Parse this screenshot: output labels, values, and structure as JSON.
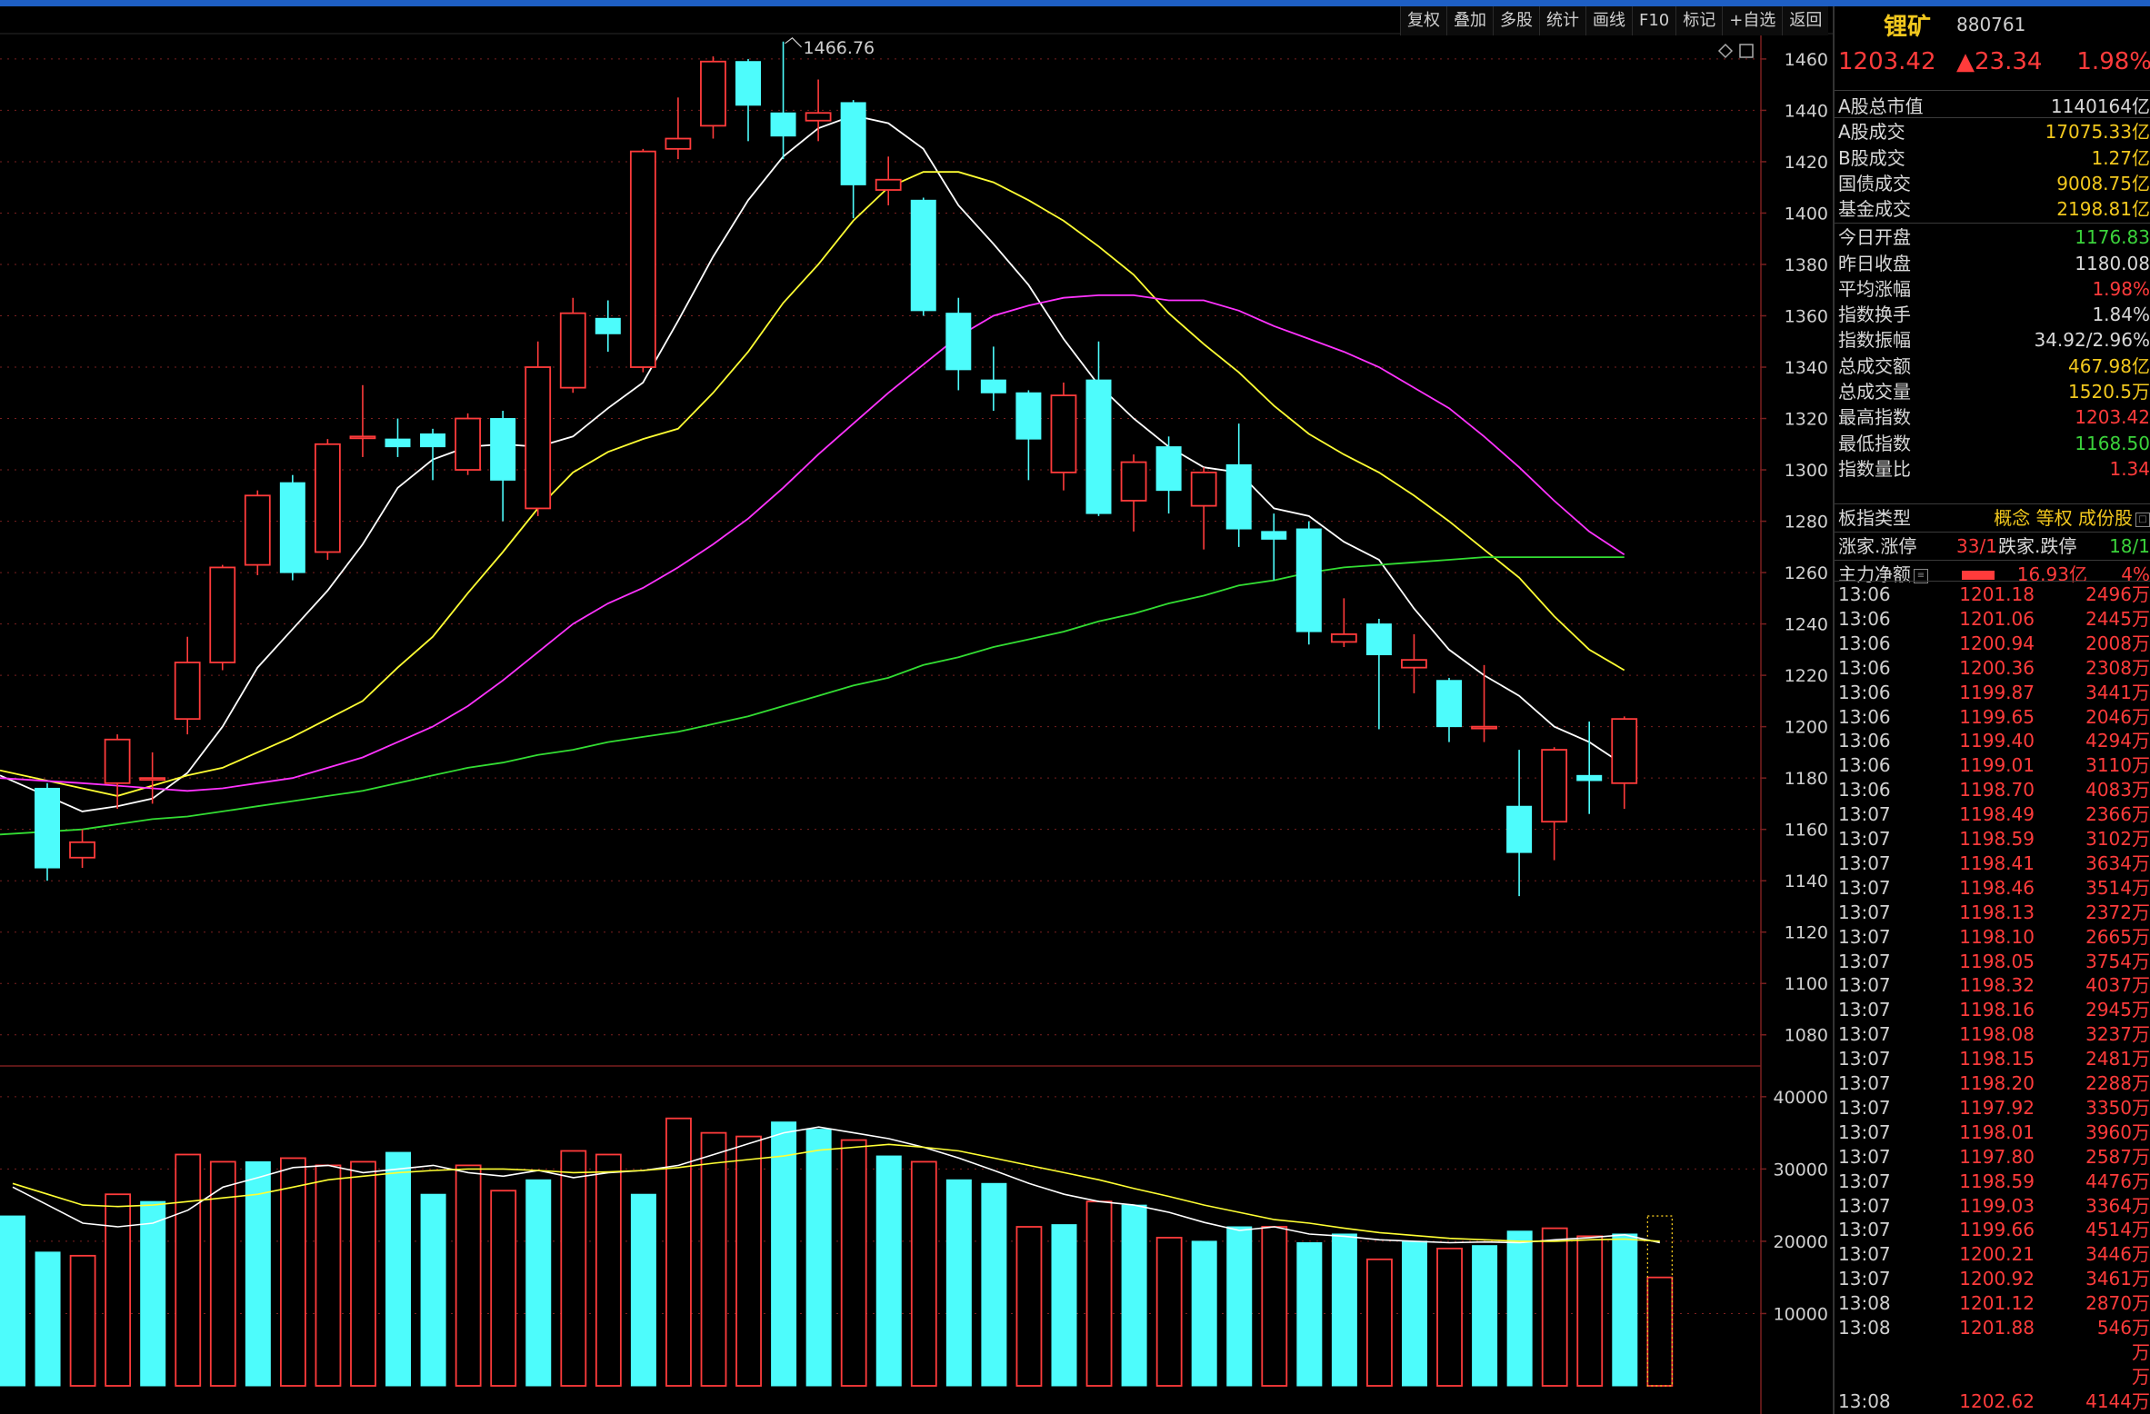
{
  "window": {
    "accent": "#1e5fc4"
  },
  "toolbar": {
    "items": [
      "复权",
      "叠加",
      "多股",
      "统计",
      "画线",
      "F10",
      "标记",
      "+自选",
      "返回"
    ]
  },
  "chart_corner_icons": [
    "diamond-icon",
    "window-toggle-icon"
  ],
  "quote": {
    "name": "锂矿",
    "code": "880761",
    "price": "1203.42",
    "change": "▲23.34",
    "change_pct": "1.98%"
  },
  "stats": [
    {
      "label": "A股总市值",
      "value": "1140164亿",
      "color": "#d8d8d8"
    },
    {
      "label": "A股成交",
      "value": "17075.33亿",
      "color": "#f2c81e"
    },
    {
      "label": "B股成交",
      "value": "1.27亿",
      "color": "#f2c81e"
    },
    {
      "label": "国债成交",
      "value": "9008.75亿",
      "color": "#f2c81e"
    },
    {
      "label": "基金成交",
      "value": "2198.81亿",
      "color": "#f2c81e"
    },
    {
      "label": "今日开盘",
      "value": "1176.83",
      "color": "#3bd33b"
    },
    {
      "label": "昨日收盘",
      "value": "1180.08",
      "color": "#d8d8d8"
    },
    {
      "label": "平均涨幅",
      "value": "1.98%",
      "color": "#ff3b3b"
    },
    {
      "label": "指数换手",
      "value": "1.84%",
      "color": "#d8d8d8"
    },
    {
      "label": "指数振幅",
      "value": "34.92/2.96%",
      "color": "#d8d8d8"
    },
    {
      "label": "总成交额",
      "value": "467.98亿",
      "color": "#f2c81e"
    },
    {
      "label": "总成交量",
      "value": "1520.5万",
      "color": "#f2c81e"
    },
    {
      "label": "最高指数",
      "value": "1203.42",
      "color": "#ff3b3b"
    },
    {
      "label": "最低指数",
      "value": "1168.50",
      "color": "#3bd33b"
    },
    {
      "label": "指数量比",
      "value": "1.34",
      "color": "#ff3b3b"
    }
  ],
  "board": {
    "label": "板指类型",
    "types": "概念 等权 成份股"
  },
  "updown": {
    "up_label": "涨家.涨停",
    "up_value": "33/1",
    "down_label": "跌家.跌停",
    "down_value": "18/1"
  },
  "mainflow": {
    "label": "主力净额",
    "value": "16.93亿",
    "pct": "4%"
  },
  "ticks": [
    {
      "t": "13:06",
      "p": "1201.18",
      "v": "2496万"
    },
    {
      "t": "13:06",
      "p": "1201.06",
      "v": "2445万"
    },
    {
      "t": "13:06",
      "p": "1200.94",
      "v": "2008万"
    },
    {
      "t": "13:06",
      "p": "1200.36",
      "v": "2308万"
    },
    {
      "t": "13:06",
      "p": "1199.87",
      "v": "3441万"
    },
    {
      "t": "13:06",
      "p": "1199.65",
      "v": "2046万"
    },
    {
      "t": "13:06",
      "p": "1199.40",
      "v": "4294万"
    },
    {
      "t": "13:06",
      "p": "1199.01",
      "v": "3110万"
    },
    {
      "t": "13:06",
      "p": "1198.70",
      "v": "4083万"
    },
    {
      "t": "13:07",
      "p": "1198.49",
      "v": "2366万"
    },
    {
      "t": "13:07",
      "p": "1198.59",
      "v": "3102万"
    },
    {
      "t": "13:07",
      "p": "1198.41",
      "v": "3634万"
    },
    {
      "t": "13:07",
      "p": "1198.46",
      "v": "3514万"
    },
    {
      "t": "13:07",
      "p": "1198.13",
      "v": "2372万"
    },
    {
      "t": "13:07",
      "p": "1198.10",
      "v": "2665万"
    },
    {
      "t": "13:07",
      "p": "1198.05",
      "v": "3754万"
    },
    {
      "t": "13:07",
      "p": "1198.32",
      "v": "4037万"
    },
    {
      "t": "13:07",
      "p": "1198.16",
      "v": "2945万"
    },
    {
      "t": "13:07",
      "p": "1198.08",
      "v": "3237万"
    },
    {
      "t": "13:07",
      "p": "1198.15",
      "v": "2481万"
    },
    {
      "t": "13:07",
      "p": "1198.20",
      "v": "2288万"
    },
    {
      "t": "13:07",
      "p": "1197.92",
      "v": "3350万"
    },
    {
      "t": "13:07",
      "p": "1198.01",
      "v": "3960万"
    },
    {
      "t": "13:07",
      "p": "1197.80",
      "v": "2587万"
    },
    {
      "t": "13:07",
      "p": "1198.59",
      "v": "4476万"
    },
    {
      "t": "13:07",
      "p": "1199.03",
      "v": "3364万"
    },
    {
      "t": "13:07",
      "p": "1199.66",
      "v": "4514万"
    },
    {
      "t": "13:07",
      "p": "1200.21",
      "v": "3446万"
    },
    {
      "t": "13:07",
      "p": "1200.92",
      "v": "3461万"
    },
    {
      "t": "13:08",
      "p": "1201.12",
      "v": "2870万"
    },
    {
      "t": "13:08",
      "p": "1201.88",
      "v": "546万"
    },
    {
      "t": "",
      "p": "",
      "v": "万"
    },
    {
      "t": "",
      "p": "",
      "v": "万"
    },
    {
      "t": "13:08",
      "p": "1202.62",
      "v": "4144万"
    }
  ],
  "colors": {
    "up": "#ff3b3b",
    "down": "#4dfcfc",
    "ma5": "#ffffff",
    "ma10": "#ffff33",
    "ma20": "#ff33ff",
    "ma60": "#33dd33",
    "grid": "#7a1f1f"
  },
  "chart_data": {
    "type": "candlestick",
    "price_axis": {
      "ylim": [
        1070,
        1472
      ],
      "ticks": [
        1080,
        1100,
        1120,
        1140,
        1160,
        1180,
        1200,
        1220,
        1240,
        1260,
        1280,
        1300,
        1320,
        1340,
        1360,
        1380,
        1400,
        1420,
        1440,
        1460
      ]
    },
    "max_label": "1466.76",
    "max_value": 1466.76,
    "candles": [
      {
        "o": 1176,
        "c": 1145,
        "h": 1178,
        "l": 1140
      },
      {
        "o": 1149,
        "c": 1155,
        "h": 1160,
        "l": 1145
      },
      {
        "o": 1178,
        "c": 1195,
        "h": 1197,
        "l": 1168
      },
      {
        "o": 1180,
        "c": 1180,
        "h": 1190,
        "l": 1170
      },
      {
        "o": 1203,
        "c": 1225,
        "h": 1235,
        "l": 1197
      },
      {
        "o": 1225,
        "c": 1262,
        "h": 1263,
        "l": 1222
      },
      {
        "o": 1263,
        "c": 1290,
        "h": 1292,
        "l": 1259
      },
      {
        "o": 1295,
        "c": 1260,
        "h": 1298,
        "l": 1257
      },
      {
        "o": 1268,
        "c": 1310,
        "h": 1312,
        "l": 1265
      },
      {
        "o": 1313,
        "c": 1313,
        "h": 1333,
        "l": 1305
      },
      {
        "o": 1312,
        "c": 1309,
        "h": 1320,
        "l": 1305
      },
      {
        "o": 1314,
        "c": 1309,
        "h": 1316,
        "l": 1296
      },
      {
        "o": 1300,
        "c": 1320,
        "h": 1322,
        "l": 1298
      },
      {
        "o": 1320,
        "c": 1296,
        "h": 1323,
        "l": 1280
      },
      {
        "o": 1285,
        "c": 1340,
        "h": 1350,
        "l": 1282
      },
      {
        "o": 1332,
        "c": 1361,
        "h": 1367,
        "l": 1330
      },
      {
        "o": 1359,
        "c": 1353,
        "h": 1366,
        "l": 1346
      },
      {
        "o": 1340,
        "c": 1424,
        "h": 1425,
        "l": 1338
      },
      {
        "o": 1425,
        "c": 1429,
        "h": 1445,
        "l": 1421
      },
      {
        "o": 1434,
        "c": 1459,
        "h": 1461,
        "l": 1429
      },
      {
        "o": 1459,
        "c": 1442,
        "h": 1460,
        "l": 1428
      },
      {
        "o": 1439,
        "c": 1430,
        "h": 1466.76,
        "l": 1421
      },
      {
        "o": 1436,
        "c": 1439,
        "h": 1452,
        "l": 1428
      },
      {
        "o": 1443,
        "c": 1411,
        "h": 1444,
        "l": 1398
      },
      {
        "o": 1409,
        "c": 1413,
        "h": 1422,
        "l": 1403
      },
      {
        "o": 1405,
        "c": 1362,
        "h": 1406,
        "l": 1360
      },
      {
        "o": 1361,
        "c": 1339,
        "h": 1367,
        "l": 1331
      },
      {
        "o": 1335,
        "c": 1330,
        "h": 1348,
        "l": 1323
      },
      {
        "o": 1330,
        "c": 1312,
        "h": 1331,
        "l": 1296
      },
      {
        "o": 1299,
        "c": 1329,
        "h": 1334,
        "l": 1292
      },
      {
        "o": 1335,
        "c": 1283,
        "h": 1350,
        "l": 1282
      },
      {
        "o": 1288,
        "c": 1303,
        "h": 1306,
        "l": 1276
      },
      {
        "o": 1309,
        "c": 1292,
        "h": 1313,
        "l": 1283
      },
      {
        "o": 1286,
        "c": 1299,
        "h": 1301,
        "l": 1269
      },
      {
        "o": 1302,
        "c": 1277,
        "h": 1318,
        "l": 1270
      },
      {
        "o": 1276,
        "c": 1273,
        "h": 1283,
        "l": 1257
      },
      {
        "o": 1277,
        "c": 1237,
        "h": 1280,
        "l": 1232
      },
      {
        "o": 1233,
        "c": 1236,
        "h": 1250,
        "l": 1231
      },
      {
        "o": 1240,
        "c": 1228,
        "h": 1242,
        "l": 1199
      },
      {
        "o": 1223,
        "c": 1226,
        "h": 1236,
        "l": 1213
      },
      {
        "o": 1218,
        "c": 1200,
        "h": 1219,
        "l": 1194
      },
      {
        "o": 1200,
        "c": 1200,
        "h": 1224,
        "l": 1194
      },
      {
        "o": 1169,
        "c": 1151,
        "h": 1191,
        "l": 1134
      },
      {
        "o": 1163,
        "c": 1191,
        "h": 1192,
        "l": 1148
      },
      {
        "o": 1181,
        "c": 1179,
        "h": 1202,
        "l": 1166
      },
      {
        "o": 1178,
        "c": 1203,
        "h": 1204,
        "l": 1168
      }
    ],
    "ma_lines": [
      {
        "name": "MA5",
        "values": [
          1181,
          1167,
          1169,
          1172,
          1182,
          1200,
          1223,
          1238,
          1253,
          1271,
          1293,
          1304,
          1309,
          1310,
          1309,
          1313,
          1324,
          1334,
          1358,
          1383,
          1405,
          1422,
          1433,
          1438,
          1435,
          1425,
          1403,
          1388,
          1372,
          1351,
          1333,
          1320,
          1309,
          1301,
          1299,
          1285,
          1282,
          1272,
          1265,
          1246,
          1230,
          1220,
          1212,
          1200,
          1194,
          1185
        ]
      },
      {
        "name": "MA10",
        "values": [
          1183,
          1176,
          1173,
          1177,
          1181,
          1184,
          1190,
          1196,
          1203,
          1210,
          1223,
          1235,
          1252,
          1268,
          1285,
          1299,
          1307,
          1312,
          1316,
          1330,
          1346,
          1365,
          1380,
          1397,
          1410,
          1416,
          1416,
          1412,
          1405,
          1397,
          1387,
          1376,
          1361,
          1349,
          1338,
          1325,
          1314,
          1306,
          1299,
          1290,
          1280,
          1269,
          1258,
          1243,
          1230,
          1222
        ]
      },
      {
        "name": "MA20",
        "values": [
          1180,
          1178,
          1177,
          1176,
          1175,
          1176,
          1178,
          1180,
          1184,
          1188,
          1194,
          1200,
          1208,
          1218,
          1229,
          1240,
          1248,
          1254,
          1262,
          1271,
          1281,
          1293,
          1306,
          1318,
          1330,
          1341,
          1352,
          1360,
          1364,
          1367,
          1368,
          1368,
          1366,
          1366,
          1362,
          1356,
          1351,
          1346,
          1340,
          1332,
          1324,
          1313,
          1301,
          1288,
          1276,
          1267
        ]
      },
      {
        "name": "MA60",
        "values": [
          1158,
          1160,
          1162,
          1164,
          1165,
          1167,
          1169,
          1171,
          1173,
          1175,
          1178,
          1181,
          1184,
          1186,
          1189,
          1191,
          1194,
          1196,
          1198,
          1201,
          1204,
          1208,
          1212,
          1216,
          1219,
          1224,
          1227,
          1231,
          1234,
          1237,
          1241,
          1244,
          1248,
          1251,
          1255,
          1257,
          1260,
          1262,
          1263,
          1264,
          1265,
          1266,
          1266,
          1266,
          1266,
          1266
        ]
      }
    ],
    "volume_axis": {
      "ylim": [
        0,
        43500
      ],
      "ticks": [
        10000,
        20000,
        30000,
        40000
      ]
    },
    "volume": [
      23500,
      18500,
      18000,
      26500,
      25500,
      32000,
      31000,
      31000,
      31500,
      30500,
      31000,
      32300,
      26500,
      30500,
      27000,
      28500,
      32500,
      32000,
      26500,
      37000,
      35000,
      34500,
      36500,
      35500,
      34000,
      31800,
      31000,
      28500,
      28000,
      22000,
      22300,
      25500,
      25000,
      20500,
      20000,
      22000,
      22000,
      19800,
      21000,
      17500,
      20000,
      19000,
      19400,
      21400,
      21800,
      20700,
      21000,
      15000
    ],
    "volume_up": [
      0,
      0,
      1,
      1,
      0,
      1,
      1,
      0,
      1,
      1,
      1,
      0,
      0,
      1,
      1,
      0,
      1,
      1,
      0,
      1,
      1,
      1,
      0,
      0,
      1,
      0,
      1,
      0,
      0,
      1,
      0,
      1,
      0,
      1,
      0,
      0,
      1,
      0,
      0,
      1,
      0,
      1,
      0,
      0,
      1,
      1,
      0,
      1
    ],
    "volume_ma": [
      {
        "name": "VMA5",
        "values": [
          27500,
          25000,
          22500,
          22000,
          22500,
          24300,
          27500,
          28800,
          30200,
          30500,
          29500,
          30000,
          30500,
          29500,
          29000,
          29800,
          28800,
          29500,
          29800,
          30500,
          32000,
          33500,
          35000,
          35800,
          35000,
          34200,
          33000,
          31500,
          29800,
          28000,
          26500,
          25500,
          25000,
          24000,
          22600,
          21500,
          22000,
          21000,
          20700,
          20200,
          20000,
          19800,
          19900,
          19800,
          20200,
          20500,
          20900,
          19800
        ]
      },
      {
        "name": "VMA10",
        "values": [
          28000,
          26500,
          25000,
          24800,
          25000,
          25500,
          26000,
          26500,
          27500,
          28500,
          29000,
          29500,
          29800,
          30000,
          30000,
          29800,
          29500,
          29600,
          29800,
          30200,
          30800,
          31300,
          31800,
          32600,
          33000,
          33400,
          33000,
          32500,
          31500,
          30500,
          29500,
          28500,
          27300,
          26200,
          25000,
          24000,
          23000,
          22500,
          21800,
          21200,
          20800,
          20400,
          20200,
          20000,
          20000,
          20200,
          20300,
          20000
        ]
      }
    ]
  }
}
